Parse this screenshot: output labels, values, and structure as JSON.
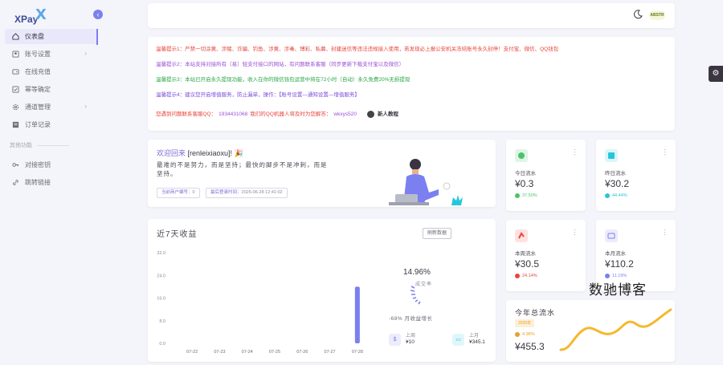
{
  "brand": {
    "logo_text": "XPay",
    "logo_mark": "X"
  },
  "sidebar": {
    "items": [
      {
        "label": "仪表盘",
        "icon": "home-icon",
        "active": true
      },
      {
        "label": "账号设置",
        "icon": "user-card-icon",
        "has_arrow": true
      },
      {
        "label": "在线充值",
        "icon": "wallet-icon"
      },
      {
        "label": "幂等确定",
        "icon": "check-square-icon"
      },
      {
        "label": "通道管理",
        "icon": "gear-icon",
        "has_arrow": true
      },
      {
        "label": "订单记录",
        "icon": "list-icon"
      }
    ],
    "section_title": "其他功能",
    "items2": [
      {
        "label": "对接密钥",
        "icon": "key-icon"
      },
      {
        "label": "跳转链接",
        "icon": "link-icon"
      }
    ]
  },
  "topbar": {
    "avatar_text": "ABSTR"
  },
  "notices": [
    {
      "text": "温馨提示1：严禁一切涂黄、涉赌、诈骗、钓鱼、涉黄、涉毒、博彩、私募、封建迷信等违法违规接入使用，若发现必上报公安机关冻结账号永久封停！支付宝、微信、QQ钱包",
      "color": "red"
    },
    {
      "text": "温馨提示2：本站支持对接所有（易）轻支付接口的网站，有问题联系客服（同步更新下载支付宝以及微信）",
      "color": "purple"
    },
    {
      "text": "温馨提示3：本站已开启永久提现功能，收入在你的微信钱包运营中将在72小时（自动）永久免费20%无损提现",
      "color": "green"
    },
    {
      "text": "温馨提示4：建议您开启增值服务，防止漏单，操作：【账号设置—通知设置—增值服务】",
      "color": "blue"
    }
  ],
  "contact": {
    "prefix": "您遇到问题联系客服QQ：",
    "qq": "1934431068",
    "middle": "我们的QQ机器人将及时为您解答：",
    "value": "wkxys520",
    "novice": "新人教程"
  },
  "welcome": {
    "title_prefix": "欢迎回来",
    "username": "[renleixiaoxu]!",
    "emoji": "🎉",
    "quote": "最难的不是努力，而是坚持；最快的脚步不是冲刺，而是坚持。",
    "badge1_label": "当前商户编号：",
    "badge1_value": "0",
    "badge2_label": "最后登录时间：",
    "badge2_value": "2025-06-28 12:41:02"
  },
  "chart_card": {
    "title": "近7天收益",
    "button": "刷新数据",
    "rate_value": "14.96%",
    "rate_label": "成交率",
    "growth": "-68% 月收益增长",
    "mini1_label": "上周",
    "mini1_value": "¥10",
    "mini2_label": "上月",
    "mini2_value": "¥345.1"
  },
  "chart_data": {
    "type": "bar",
    "categories": [
      "07-22",
      "07-23",
      "07-24",
      "07-25",
      "07-26",
      "07-27",
      "07-28"
    ],
    "values": [
      0,
      0,
      0,
      0,
      0,
      0,
      20
    ],
    "yticks": [
      "32.0",
      "24.0",
      "16.0",
      "8.0",
      "0.0"
    ],
    "ylim": [
      0,
      32
    ],
    "color": "#7b7ff0"
  },
  "stats": [
    {
      "label": "今日流水",
      "value": "¥0.3",
      "pct": "37.50%",
      "color": "#4cc36a",
      "icon": "dollar-icon",
      "trend": "up"
    },
    {
      "label": "昨日流水",
      "value": "¥30.2",
      "pct": "44.44%",
      "color": "#26c6da",
      "icon": "chart-icon",
      "trend": "down"
    },
    {
      "label": "本周流水",
      "value": "¥30.5",
      "pct": "24.14%",
      "color": "#e8453c",
      "icon": "trend-icon",
      "trend": "down"
    },
    {
      "label": "本月流水",
      "value": "¥110.2",
      "pct": "11.19%",
      "color": "#7b7ff0",
      "icon": "calendar-icon",
      "trend": "up"
    }
  ],
  "year": {
    "title": "今年总流水",
    "tag": "2025年",
    "pct": "4.98%",
    "value": "¥455.3",
    "color": "#f5b82e"
  },
  "watermark": "数驰博客"
}
